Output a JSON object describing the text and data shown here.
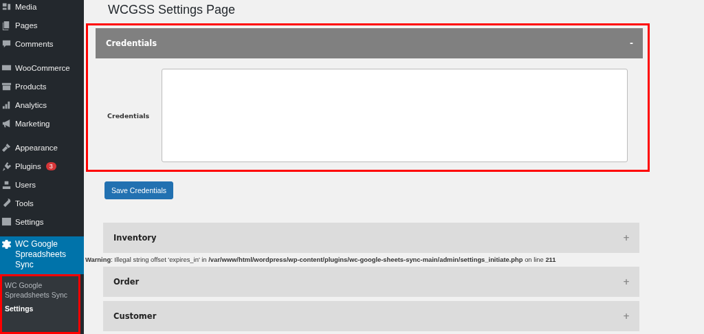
{
  "sidebar": {
    "groups": [
      [
        {
          "label": "Media",
          "selected": false
        },
        {
          "label": "Pages",
          "selected": false
        },
        {
          "label": "Comments",
          "selected": false
        }
      ],
      [
        {
          "label": "WooCommerce",
          "selected": false
        },
        {
          "label": "Products",
          "selected": false
        },
        {
          "label": "Analytics",
          "selected": false
        },
        {
          "label": "Marketing",
          "selected": false
        }
      ],
      [
        {
          "label": "Appearance",
          "selected": false
        },
        {
          "label": "Plugins",
          "selected": false,
          "badge": "3"
        },
        {
          "label": "Users",
          "selected": false
        },
        {
          "label": "Tools",
          "selected": false
        },
        {
          "label": "Settings",
          "selected": false
        }
      ],
      [
        {
          "label": "WC Google Spreadsheets Sync",
          "selected": true
        }
      ]
    ],
    "submenu": {
      "highlighted": true,
      "items": [
        {
          "label": "WC Google Spreadsheets Sync",
          "selected": false
        },
        {
          "label": "Settings",
          "selected": true
        }
      ]
    }
  },
  "page_title": "WCGSS Settings Page",
  "sections": [
    {
      "kind": "panel",
      "title": "Credentials",
      "toggle": "-",
      "expanded": true,
      "highlighted": true,
      "field_label": "Credentials",
      "button": "Save Credentials"
    },
    {
      "kind": "panel",
      "title": "Inventory",
      "toggle": "+",
      "expanded": false,
      "highlighted": false
    },
    {
      "kind": "warning",
      "text": "**Warning**: Illegal string offset 'expires_in' in **/var/www/html/wordpress/wp-content/plugins/wc-google-sheets-sync-main/admin/settings_initiate.php** on line **211**"
    },
    {
      "kind": "panel",
      "title": "Order",
      "toggle": "+",
      "expanded": false,
      "highlighted": false
    },
    {
      "kind": "panel",
      "title": "Customer",
      "toggle": "+",
      "expanded": false,
      "highlighted": false
    }
  ]
}
